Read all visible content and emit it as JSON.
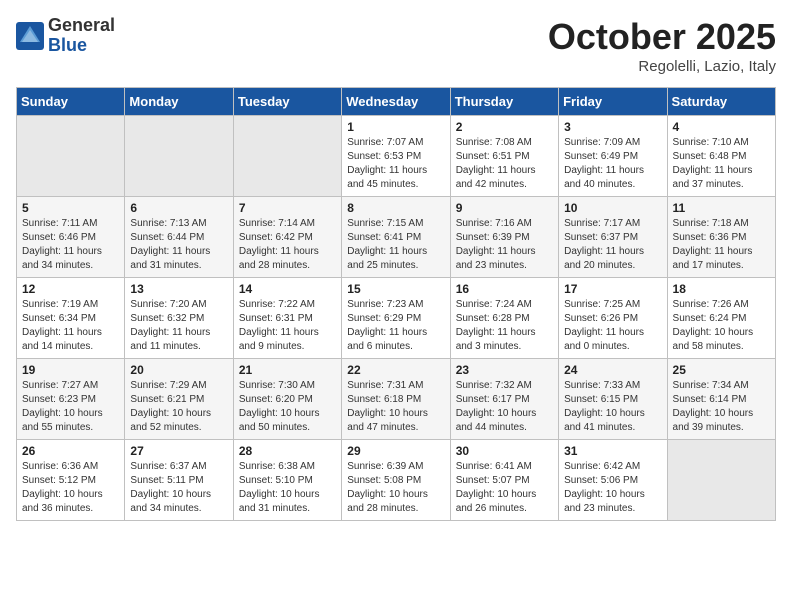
{
  "header": {
    "logo_general": "General",
    "logo_blue": "Blue",
    "month": "October 2025",
    "location": "Regolelli, Lazio, Italy"
  },
  "weekdays": [
    "Sunday",
    "Monday",
    "Tuesday",
    "Wednesday",
    "Thursday",
    "Friday",
    "Saturday"
  ],
  "weeks": [
    [
      {
        "day": "",
        "info": ""
      },
      {
        "day": "",
        "info": ""
      },
      {
        "day": "",
        "info": ""
      },
      {
        "day": "1",
        "info": "Sunrise: 7:07 AM\nSunset: 6:53 PM\nDaylight: 11 hours\nand 45 minutes."
      },
      {
        "day": "2",
        "info": "Sunrise: 7:08 AM\nSunset: 6:51 PM\nDaylight: 11 hours\nand 42 minutes."
      },
      {
        "day": "3",
        "info": "Sunrise: 7:09 AM\nSunset: 6:49 PM\nDaylight: 11 hours\nand 40 minutes."
      },
      {
        "day": "4",
        "info": "Sunrise: 7:10 AM\nSunset: 6:48 PM\nDaylight: 11 hours\nand 37 minutes."
      }
    ],
    [
      {
        "day": "5",
        "info": "Sunrise: 7:11 AM\nSunset: 6:46 PM\nDaylight: 11 hours\nand 34 minutes."
      },
      {
        "day": "6",
        "info": "Sunrise: 7:13 AM\nSunset: 6:44 PM\nDaylight: 11 hours\nand 31 minutes."
      },
      {
        "day": "7",
        "info": "Sunrise: 7:14 AM\nSunset: 6:42 PM\nDaylight: 11 hours\nand 28 minutes."
      },
      {
        "day": "8",
        "info": "Sunrise: 7:15 AM\nSunset: 6:41 PM\nDaylight: 11 hours\nand 25 minutes."
      },
      {
        "day": "9",
        "info": "Sunrise: 7:16 AM\nSunset: 6:39 PM\nDaylight: 11 hours\nand 23 minutes."
      },
      {
        "day": "10",
        "info": "Sunrise: 7:17 AM\nSunset: 6:37 PM\nDaylight: 11 hours\nand 20 minutes."
      },
      {
        "day": "11",
        "info": "Sunrise: 7:18 AM\nSunset: 6:36 PM\nDaylight: 11 hours\nand 17 minutes."
      }
    ],
    [
      {
        "day": "12",
        "info": "Sunrise: 7:19 AM\nSunset: 6:34 PM\nDaylight: 11 hours\nand 14 minutes."
      },
      {
        "day": "13",
        "info": "Sunrise: 7:20 AM\nSunset: 6:32 PM\nDaylight: 11 hours\nand 11 minutes."
      },
      {
        "day": "14",
        "info": "Sunrise: 7:22 AM\nSunset: 6:31 PM\nDaylight: 11 hours\nand 9 minutes."
      },
      {
        "day": "15",
        "info": "Sunrise: 7:23 AM\nSunset: 6:29 PM\nDaylight: 11 hours\nand 6 minutes."
      },
      {
        "day": "16",
        "info": "Sunrise: 7:24 AM\nSunset: 6:28 PM\nDaylight: 11 hours\nand 3 minutes."
      },
      {
        "day": "17",
        "info": "Sunrise: 7:25 AM\nSunset: 6:26 PM\nDaylight: 11 hours\nand 0 minutes."
      },
      {
        "day": "18",
        "info": "Sunrise: 7:26 AM\nSunset: 6:24 PM\nDaylight: 10 hours\nand 58 minutes."
      }
    ],
    [
      {
        "day": "19",
        "info": "Sunrise: 7:27 AM\nSunset: 6:23 PM\nDaylight: 10 hours\nand 55 minutes."
      },
      {
        "day": "20",
        "info": "Sunrise: 7:29 AM\nSunset: 6:21 PM\nDaylight: 10 hours\nand 52 minutes."
      },
      {
        "day": "21",
        "info": "Sunrise: 7:30 AM\nSunset: 6:20 PM\nDaylight: 10 hours\nand 50 minutes."
      },
      {
        "day": "22",
        "info": "Sunrise: 7:31 AM\nSunset: 6:18 PM\nDaylight: 10 hours\nand 47 minutes."
      },
      {
        "day": "23",
        "info": "Sunrise: 7:32 AM\nSunset: 6:17 PM\nDaylight: 10 hours\nand 44 minutes."
      },
      {
        "day": "24",
        "info": "Sunrise: 7:33 AM\nSunset: 6:15 PM\nDaylight: 10 hours\nand 41 minutes."
      },
      {
        "day": "25",
        "info": "Sunrise: 7:34 AM\nSunset: 6:14 PM\nDaylight: 10 hours\nand 39 minutes."
      }
    ],
    [
      {
        "day": "26",
        "info": "Sunrise: 6:36 AM\nSunset: 5:12 PM\nDaylight: 10 hours\nand 36 minutes."
      },
      {
        "day": "27",
        "info": "Sunrise: 6:37 AM\nSunset: 5:11 PM\nDaylight: 10 hours\nand 34 minutes."
      },
      {
        "day": "28",
        "info": "Sunrise: 6:38 AM\nSunset: 5:10 PM\nDaylight: 10 hours\nand 31 minutes."
      },
      {
        "day": "29",
        "info": "Sunrise: 6:39 AM\nSunset: 5:08 PM\nDaylight: 10 hours\nand 28 minutes."
      },
      {
        "day": "30",
        "info": "Sunrise: 6:41 AM\nSunset: 5:07 PM\nDaylight: 10 hours\nand 26 minutes."
      },
      {
        "day": "31",
        "info": "Sunrise: 6:42 AM\nSunset: 5:06 PM\nDaylight: 10 hours\nand 23 minutes."
      },
      {
        "day": "",
        "info": ""
      }
    ]
  ]
}
